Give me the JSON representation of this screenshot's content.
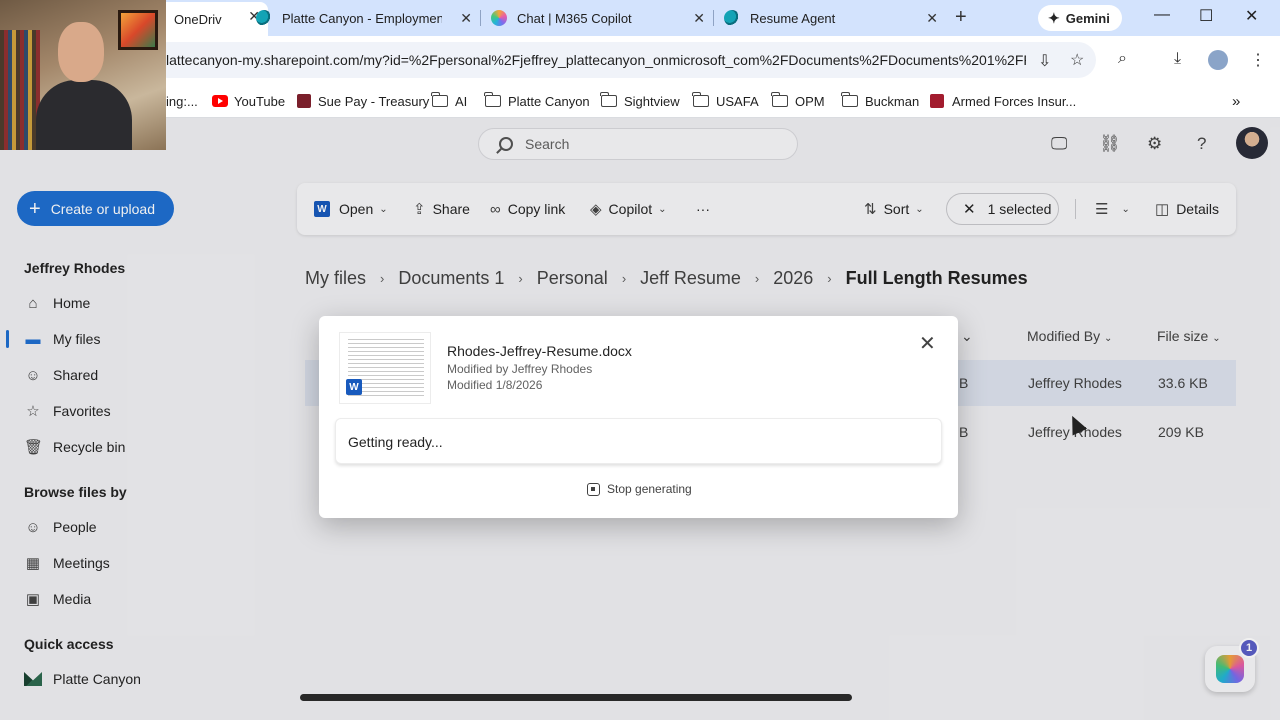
{
  "browser": {
    "tabs": [
      {
        "label": "OneDriv",
        "active": true
      },
      {
        "label": "Platte Canyon - Employment In",
        "active": false
      },
      {
        "label": "Chat | M365 Copilot",
        "active": false
      },
      {
        "label": "Resume Agent",
        "active": false
      }
    ],
    "gemini_label": "Gemini",
    "url": "lattecanyon-my.sharepoint.com/my?id=%2Fpersonal%2Fjeffrey_plattecanyon_onmicrosoft_com%2FDocuments%2FDocuments%201%2FP...",
    "bookmarks": [
      {
        "label": "ing:..."
      },
      {
        "label": "YouTube"
      },
      {
        "label": "Sue Pay - Treasury"
      },
      {
        "label": "AI"
      },
      {
        "label": "Platte Canyon"
      },
      {
        "label": "Sightview"
      },
      {
        "label": "USAFA"
      },
      {
        "label": "OPM"
      },
      {
        "label": "Buckman"
      },
      {
        "label": "Armed Forces Insur..."
      }
    ]
  },
  "header": {
    "search_placeholder": "Search"
  },
  "sidebar": {
    "create_label": "Create or upload",
    "user_name": "Jeffrey Rhodes",
    "items": [
      {
        "label": "Home"
      },
      {
        "label": "My files"
      },
      {
        "label": "Shared"
      },
      {
        "label": "Favorites"
      },
      {
        "label": "Recycle bin"
      }
    ],
    "browse_heading": "Browse files by",
    "browse_items": [
      {
        "label": "People"
      },
      {
        "label": "Meetings"
      },
      {
        "label": "Media"
      }
    ],
    "quick_heading": "Quick access",
    "quick_items": [
      {
        "label": "Platte Canyon"
      }
    ]
  },
  "toolbar": {
    "open": "Open",
    "share": "Share",
    "copy_link": "Copy link",
    "copilot": "Copilot",
    "more": "···",
    "sort": "Sort",
    "selected": "1 selected",
    "details": "Details"
  },
  "breadcrumb": [
    "My files",
    "Documents 1",
    "Personal",
    "Jeff Resume",
    "2026",
    "Full Length Resumes"
  ],
  "file_list": {
    "columns": {
      "modified_by": "Modified By",
      "file_size": "File size"
    },
    "rows": [
      {
        "size_partial": "B",
        "modified_by": "Jeffrey Rhodes",
        "file_size": "33.6 KB"
      },
      {
        "size_partial": "B",
        "modified_by": "Jeffrey Rhodes",
        "file_size": "209 KB"
      }
    ]
  },
  "dialog": {
    "file_name": "Rhodes-Jeffrey-Resume.docx",
    "modified_by": "Modified by Jeffrey Rhodes",
    "modified_date": "Modified 1/8/2026",
    "status": "Getting ready...",
    "stop_label": "Stop generating"
  },
  "copilot_badge": "1",
  "colors": {
    "accent": "#1f6fd1",
    "selected_row": "#dde3ef",
    "tabstrip": "#d3e3fd"
  }
}
